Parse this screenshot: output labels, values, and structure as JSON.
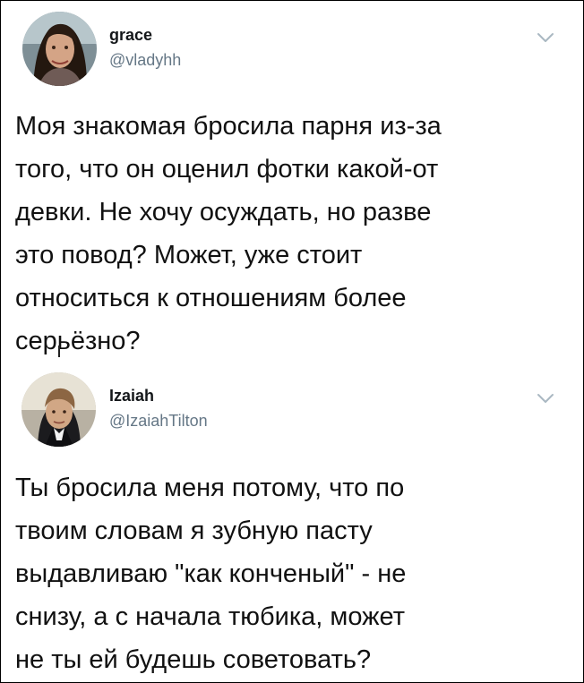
{
  "tweets": [
    {
      "name": "grace",
      "handle": "@vladyhh",
      "text": "Моя знакомая бросила парня из-за\nтого, что он оценил фотки какой-от\nдевки. Не хочу осуждать, но разве\nэто повод? Может, уже стоит\nотноситься к отношениям более\nсерьёзно?",
      "avatar_icon": "user-avatar-photo",
      "menu_icon": "chevron-down-icon"
    },
    {
      "name": "Izaiah",
      "handle": "@IzaiahTilton",
      "text": "Ты бросила меня потому, что по\nтвоим словам я зубную пасту\nвыдавливаю \"как конченый\" - не\nснизу, а с начала тюбика, может\nне ты ей будешь советовать?",
      "avatar_icon": "user-avatar-photo",
      "menu_icon": "chevron-down-icon"
    }
  ],
  "colors": {
    "name": "#14171a",
    "handle": "#657786",
    "text": "#111111",
    "chevron": "#aab8c2",
    "border": "#000000"
  }
}
